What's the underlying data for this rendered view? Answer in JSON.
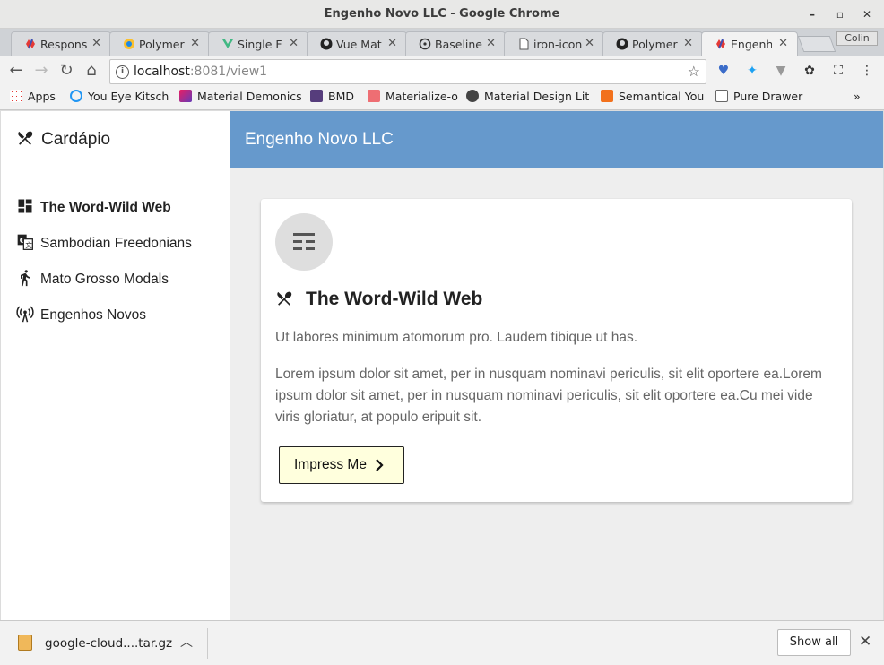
{
  "window": {
    "title": "Engenho Novo LLC - Google Chrome",
    "user": "Colin"
  },
  "tabs": [
    {
      "label": "Respons",
      "icon": "polymer-icon",
      "active": false
    },
    {
      "label": "Polymer",
      "icon": "polymer-hex-icon",
      "active": false
    },
    {
      "label": "Single F",
      "icon": "vue-icon",
      "active": false
    },
    {
      "label": "Vue Mat",
      "icon": "github-icon",
      "active": false
    },
    {
      "label": "Baseline",
      "icon": "biohazard-icon",
      "active": false
    },
    {
      "label": "iron-icon",
      "icon": "page-icon",
      "active": false
    },
    {
      "label": "Polymer",
      "icon": "github-icon",
      "active": false
    },
    {
      "label": "Engenh",
      "icon": "polymer-icon",
      "active": true
    }
  ],
  "omnibox": {
    "host": "localhost",
    "rest": ":8081/view1"
  },
  "bookmarks": [
    {
      "label": "Apps",
      "icon": "apps-grid-icon"
    },
    {
      "label": "You Eye Kitsch",
      "icon": "blue-ring-icon"
    },
    {
      "label": "Material Demonics",
      "icon": "material-square-icon"
    },
    {
      "label": "BMD",
      "icon": "bootstrap-icon"
    },
    {
      "label": "Materialize-o",
      "icon": "materialize-icon"
    },
    {
      "label": "Material Design Lit",
      "icon": "mdl-icon"
    },
    {
      "label": "Semantical You",
      "icon": "semantic-icon"
    },
    {
      "label": "Pure Drawer",
      "icon": "page-icon"
    },
    {
      "label": "»",
      "icon": "more-icon"
    }
  ],
  "drawer": {
    "title": "Cardápio",
    "items": [
      {
        "label": "The Word-Wild Web",
        "icon": "dashboard-icon",
        "selected": true
      },
      {
        "label": "Sambodian Freedonians",
        "icon": "translate-icon",
        "selected": false
      },
      {
        "label": "Mato Grosso Modals",
        "icon": "walk-icon",
        "selected": false
      },
      {
        "label": "Engenhos Novos",
        "icon": "antenna-icon",
        "selected": false
      }
    ]
  },
  "appbar": {
    "title": "Engenho Novo LLC"
  },
  "card": {
    "heading": "The Word-Wild Web",
    "subtitle": "Ut labores minimum atomorum pro. Laudem tibique ut has.",
    "body": "Lorem ipsum dolor sit amet, per in nusquam nominavi periculis, sit elit oportere ea.Lorem ipsum dolor sit amet, per in nusquam nominavi periculis, sit elit oportere ea.Cu mei vide viris gloriatur, at populo eripuit sit.",
    "button": "Impress Me"
  },
  "download": {
    "filename": "google-cloud....tar.gz",
    "show_all": "Show all"
  },
  "colors": {
    "appbar": "#6699cc",
    "button_bg": "#ffffdd",
    "page_bg": "#eeeeee"
  }
}
